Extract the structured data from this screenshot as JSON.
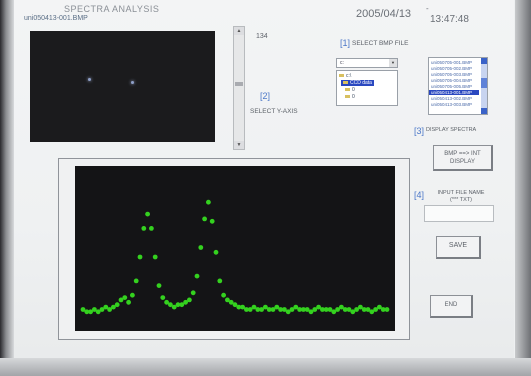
{
  "header": {
    "title": "SPECTRA ANALYSIS",
    "filename": "uni050413-001.BMP",
    "date": "2005/04/13",
    "time": "13:47:48",
    "time_prefix": "-"
  },
  "slider": {
    "value": "134",
    "level": 0.46
  },
  "steps": {
    "step1": {
      "number": "[1]",
      "label": "SELECT BMP FILE"
    },
    "step2": {
      "number": "[2]",
      "label": "SELECT  Y-AXIS"
    },
    "step3": {
      "number": "[3]",
      "label": "DISPLAY SPECTRA"
    },
    "step4": {
      "number": "[4]",
      "label_line1": "INPUT FILE NAME",
      "label_line2": "(*** TXT)"
    }
  },
  "drive": {
    "value": "c:"
  },
  "directories": [
    {
      "label": "c:\\",
      "selected": false
    },
    {
      "label": "CCD data",
      "selected": true
    },
    {
      "label": "0",
      "selected": false
    },
    {
      "label": "0",
      "selected": false
    }
  ],
  "files": [
    {
      "label": "uni050705-001.BMP",
      "selected": false
    },
    {
      "label": "uni050705-002.BMP",
      "selected": false
    },
    {
      "label": "uni050705-003.BMP",
      "selected": false
    },
    {
      "label": "uni050705-004.BMP",
      "selected": false
    },
    {
      "label": "uni050705-005.BMP",
      "selected": false
    },
    {
      "label": "uni050413-001.BMP",
      "selected": true
    },
    {
      "label": "uni050413-002.BMP",
      "selected": false
    },
    {
      "label": "uni050413-003.BMP",
      "selected": false
    }
  ],
  "buttons": {
    "convert_line1": "BMP ==> INT",
    "convert_line2": "DISPLAY",
    "save": "SAVE",
    "end": "END"
  },
  "file_name_input": {
    "value": ""
  },
  "colors": {
    "spectrum": "#34d11f",
    "accent": "#4c78c8",
    "selection": "#2a48c0"
  },
  "chart_data": {
    "type": "scatter",
    "x": [
      0,
      4,
      8,
      12,
      16,
      20,
      24,
      28,
      32,
      36,
      40,
      44,
      48,
      52,
      56,
      60,
      64,
      68,
      72,
      76,
      80,
      84,
      88,
      92,
      96,
      100,
      104,
      108,
      112,
      116,
      120,
      124,
      128,
      132,
      136,
      140,
      144,
      148,
      152,
      156,
      160,
      164,
      168,
      172,
      176,
      180,
      184,
      188,
      192,
      196,
      200,
      204,
      208,
      212,
      216,
      220,
      224,
      228,
      232,
      236,
      240,
      244,
      248,
      252,
      256,
      260,
      264,
      268,
      272,
      276,
      280,
      284,
      288,
      292,
      296,
      300,
      304,
      308,
      312,
      316,
      320
    ],
    "y": [
      4,
      3,
      3,
      4,
      3,
      4,
      5,
      4,
      5,
      6,
      8,
      9,
      7,
      10,
      16,
      26,
      38,
      44,
      38,
      26,
      14,
      9,
      7,
      6,
      5,
      6,
      6,
      7,
      8,
      11,
      18,
      30,
      42,
      49,
      41,
      28,
      16,
      10,
      8,
      7,
      6,
      5,
      5,
      4,
      4,
      5,
      4,
      4,
      5,
      4,
      4,
      5,
      4,
      4,
      3,
      4,
      5,
      4,
      4,
      4,
      3,
      4,
      5,
      4,
      4,
      4,
      3,
      4,
      5,
      4,
      4,
      3,
      4,
      5,
      4,
      4,
      3,
      4,
      5,
      4,
      4
    ],
    "xlim": [
      0,
      320
    ],
    "ylim": [
      0,
      60
    ],
    "grid": false
  }
}
